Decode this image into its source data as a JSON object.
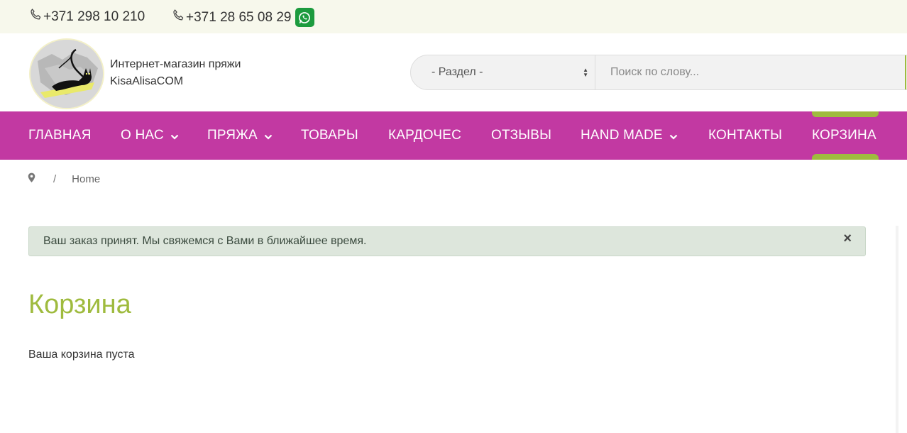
{
  "topbar": {
    "phone1": "+371 298 10 210",
    "phone2": "+371 28 65 08 29"
  },
  "header": {
    "brand_line1": "Интернет-магазин пряжи",
    "brand_line2": "KisaAlisaCOM",
    "select_value": "- Раздел -",
    "search_placeholder": "Поиск по слову..."
  },
  "nav": {
    "items": [
      {
        "label": "ГЛАВНАЯ"
      },
      {
        "label": "О НАС"
      },
      {
        "label": "ПРЯЖА"
      },
      {
        "label": "ТОВАРЫ"
      },
      {
        "label": "КАРДОЧЕС"
      },
      {
        "label": "ОТЗЫВЫ"
      },
      {
        "label": "HAND MADE"
      },
      {
        "label": "КОНТАКТЫ"
      },
      {
        "label": "КОРЗИНА"
      }
    ]
  },
  "breadcrumb": {
    "separator": "/",
    "current": "Home"
  },
  "alert": {
    "message": "Ваш заказ принят. Мы свяжемся с Вами в ближайшее время.",
    "close": "×"
  },
  "main": {
    "title": "Корзина",
    "empty_text": "Ваша корзина пуста"
  },
  "colors": {
    "nav_bg": "#c239a2",
    "accent_green": "#9fbb3e",
    "topbar_bg": "#f7f8ec",
    "alert_bg": "#dde6dc",
    "whatsapp": "#1c9b3e"
  },
  "icons": [
    "phone-icon",
    "whatsapp-icon",
    "chevron-down-icon",
    "map-marker-icon",
    "close-icon"
  ]
}
